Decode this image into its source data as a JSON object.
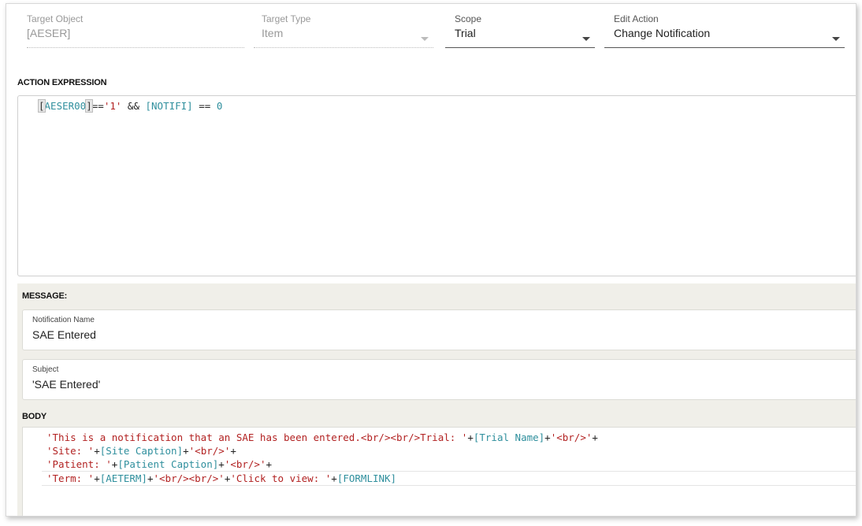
{
  "fields": {
    "target_object": {
      "label": "Target Object",
      "value": "[AESER]"
    },
    "target_type": {
      "label": "Target Type",
      "value": "Item"
    },
    "scope": {
      "label": "Scope",
      "value": "Trial"
    },
    "edit_action": {
      "label": "Edit Action",
      "value": "Change Notification"
    }
  },
  "action_expression": {
    "label": "ACTION EXPRESSION",
    "tokens": {
      "open_bracket": "[",
      "ident": "AESER00",
      "close_bracket": "]",
      "op1": "==",
      "str1": "'1'",
      "op2": " && ",
      "ident2": "[NOTIFI]",
      "op3": " == ",
      "num": "0"
    }
  },
  "message": {
    "label": "MESSAGE:",
    "notification_name": {
      "label": "Notification Name",
      "value": "SAE Entered"
    },
    "subject": {
      "label": "Subject",
      "value": "'SAE Entered'"
    },
    "body_label": "BODY",
    "body_lines": [
      {
        "s1": "'This is a notification that an SAE has been entered.<br/><br/>Trial: '",
        "p1": "+",
        "id1": "[Trial Name]",
        "p2": "+",
        "s2": "'<br/>'",
        "p3": "+"
      },
      {
        "s1": "'Site: '",
        "p1": "+",
        "id1": "[Site Caption]",
        "p2": "+",
        "s2": "'<br/>'",
        "p3": "+"
      },
      {
        "s1": "'Patient: '",
        "p1": "+",
        "id1": "[Patient Caption]",
        "p2": "+",
        "s2": "'<br/>'",
        "p3": "+"
      },
      {
        "s1": "'Term: '",
        "p1": "+",
        "id1": "[AETERM]",
        "p2": "+",
        "s2": "'<br/><br/>'",
        "p3": "+",
        "s3": "'Click to view: '",
        "p4": "+",
        "id2": "[FORMLINK]"
      }
    ]
  }
}
